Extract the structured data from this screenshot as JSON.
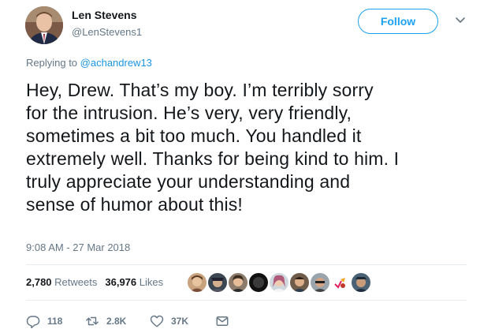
{
  "author": {
    "name": "Len Stevens",
    "handle": "@LenStevens1"
  },
  "follow_label": "Follow",
  "reply": {
    "prefix": "Replying to ",
    "target": "@achandrew13"
  },
  "tweet_lines": [
    "Hey, Drew. That’s my boy. I’m terribly sorry",
    "for the intrusion. He’s very, very friendly,",
    "sometimes a bit too much. You handled it",
    "extremely well. Thanks for being kind to him. I",
    "truly appreciate your understanding and",
    "sense of humor about this!"
  ],
  "timestamp": "9:08 AM - 27 Mar 2018",
  "stats": {
    "retweets_count": "2,780",
    "retweets_label": "Retweets",
    "likes_count": "36,976",
    "likes_label": "Likes"
  },
  "actions": {
    "reply_count": "118",
    "retweet_count": "2.8K",
    "like_count": "37K"
  },
  "icons": {
    "reply": "reply-icon",
    "retweet": "retweet-icon",
    "like": "heart-icon",
    "message": "envelope-icon",
    "caret": "chevron-down-icon"
  },
  "colors": {
    "accent": "#1da1f2",
    "link": "#1b95e0",
    "muted": "#657786",
    "text": "#14171a",
    "divider": "#e6ecf0"
  }
}
